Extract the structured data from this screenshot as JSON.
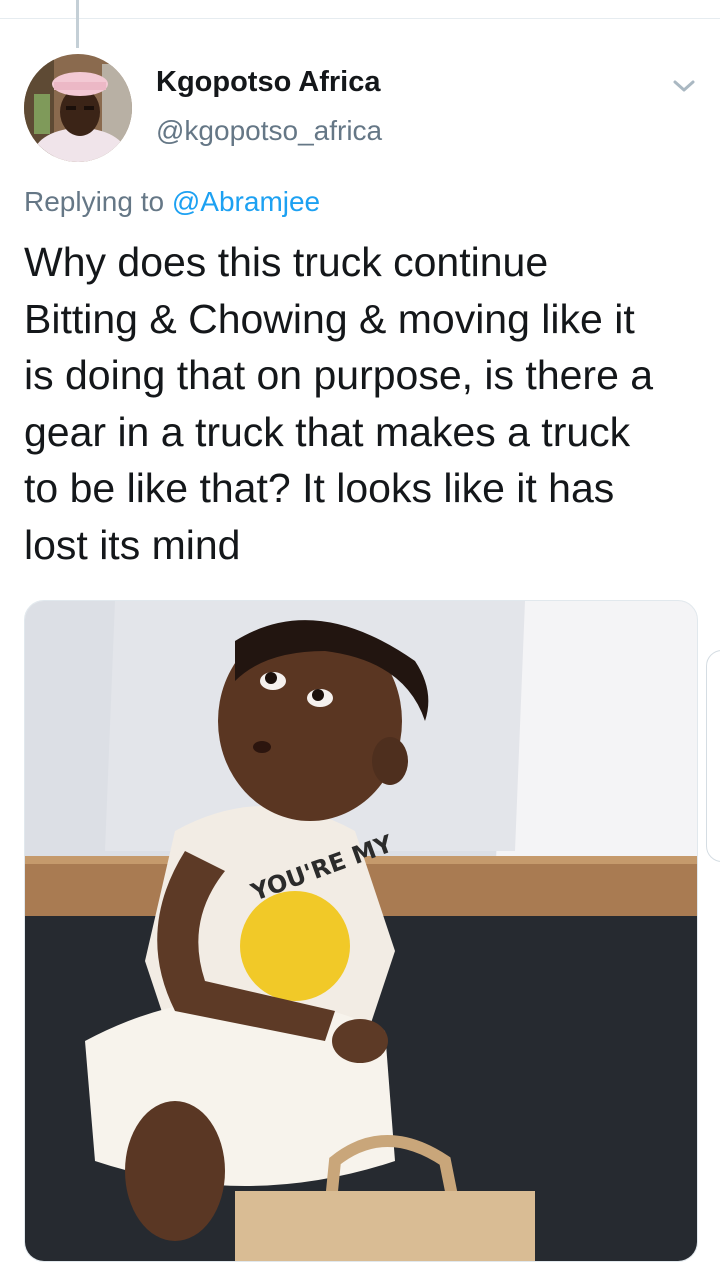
{
  "tweet": {
    "author_name": "Kgopotso Africa",
    "author_handle": "@kgopotso_africa",
    "replying_prefix": "Replying to",
    "replying_to": "@Abramjee",
    "text": "Why does this truck continue\nBitting & Chowing & moving like it\nis doing that on purpose, is there a\ngear in a truck that makes a truck\nto be like that? It looks like it has\nlost its mind"
  },
  "media": {
    "shirt_text": "YOU'RE MY"
  },
  "icons": {
    "caret": "chevron-down-icon"
  },
  "colors": {
    "link": "#1da1f2",
    "secondary_text": "#657786",
    "primary_text": "#14171a"
  }
}
